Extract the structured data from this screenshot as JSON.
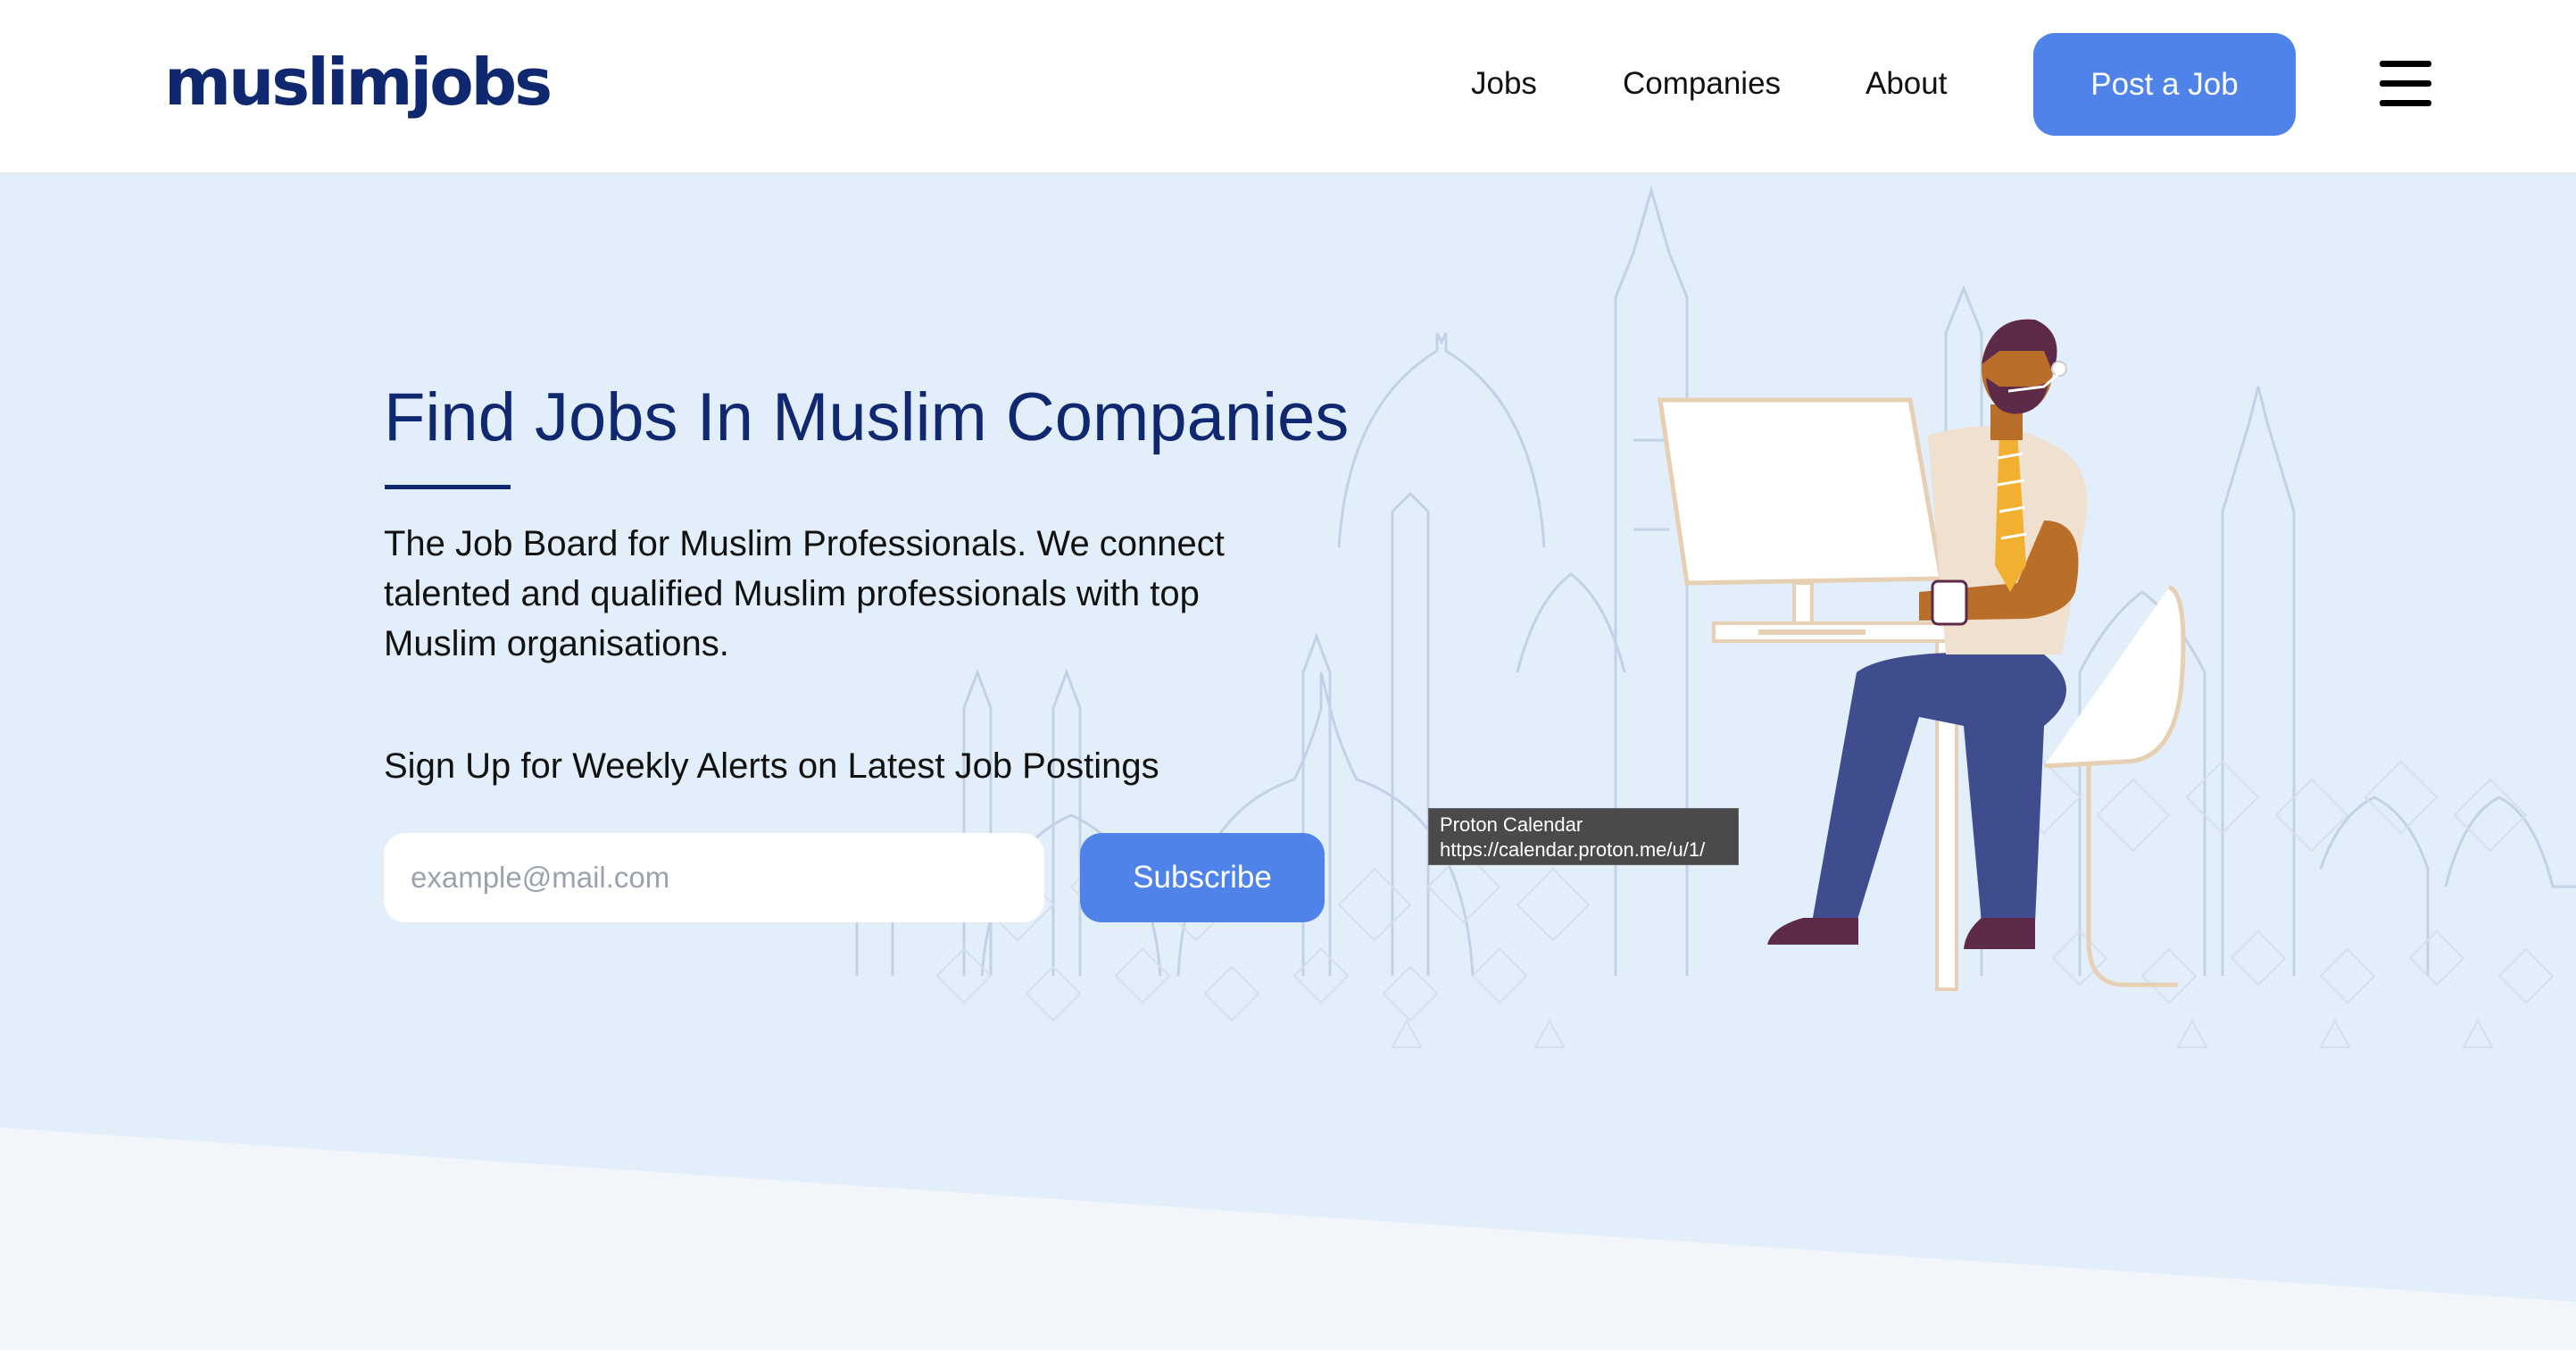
{
  "header": {
    "logo_text": "muslimjobs",
    "nav": [
      {
        "label": "Jobs"
      },
      {
        "label": "Companies"
      },
      {
        "label": "About"
      }
    ],
    "post_job_label": "Post a Job",
    "menu_icon": "hamburger-menu-icon"
  },
  "hero": {
    "title": "Find Jobs In Muslim Companies",
    "description": "The Job Board for Muslim Professionals. We connect talented and qualified Muslim professionals with top Muslim organisations.",
    "signup_heading": "Sign Up for Weekly Alerts on Latest Job Postings",
    "email_placeholder": "example@mail.com",
    "email_value": "",
    "subscribe_label": "Subscribe"
  },
  "tooltip": {
    "title": "Proton Calendar",
    "url": "https://calendar.proton.me/u/1/"
  },
  "colors": {
    "brand_navy": "#10286f",
    "accent_blue": "#4f83ea",
    "hero_background": "#e2eef9"
  }
}
